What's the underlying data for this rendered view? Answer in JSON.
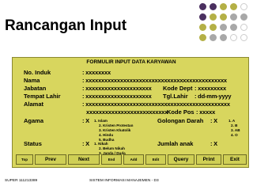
{
  "slide": {
    "title": "Rancangan Input"
  },
  "form": {
    "title": "FORMULIR INPUT DATA KARYAWAN",
    "fields": [
      {
        "label": "No. Induk",
        "value": ": xxxxxxxx"
      },
      {
        "label": "Nama",
        "value": ": xxxxxxxxxxxxxxxxxxxxxxxxxxxxxxxxxxxxxxxxxxxxx"
      },
      {
        "label": "Jabatan",
        "value": ": xxxxxxxxxxxxxxxxxxxxx",
        "extra_label": "Kode Dept",
        "extra_value": ": xxxxxxxxx"
      },
      {
        "label": "Tempat Lahir",
        "value": ": xxxxxxxxxxxxxxxxxxxxx",
        "extra_label": "Tgl.Lahir",
        "extra_value": ": dd-mm-yyyy"
      },
      {
        "label": "Alamat",
        "value": ": xxxxxxxxxxxxxxxxxxxxxxxxxxxxxxxxxxxxxxxxxxxxxx",
        "value_line2": "xxxxxxxxxxxxxxxxxxxxxxxxxx",
        "extra_label": "Kode Pos",
        "extra_value": ": xxxxx"
      },
      {
        "label": "Agama",
        "value": ": X"
      },
      {
        "label": "Status",
        "value": ": X"
      }
    ],
    "agama_options": [
      "1. Islam",
      "2. Kristen Protestan",
      "3. Kristen Khatolik",
      "4. Hindu",
      "5. Budha"
    ],
    "golongan": {
      "label": "Golongan Darah",
      "value": ": X",
      "options": [
        "1.  A",
        "2.  B",
        "3. AB",
        "4.  O"
      ]
    },
    "status_options": [
      "1. Nikah",
      "2. Belum Nikah",
      "3. Janda / Duda"
    ],
    "jumlah_anak": {
      "label": "Jumlah anak",
      "value": ": X"
    },
    "buttons": {
      "top": "Top",
      "prev": "Prev",
      "next": "Next",
      "end": "End",
      "add": "Add",
      "edit": "Edit",
      "query": "Query",
      "print": "Print",
      "exit": "Exit"
    }
  },
  "footer": {
    "left": "SUPER 111213389",
    "center": "SISTEM INFORMASI MANAJEMEN - D3"
  }
}
